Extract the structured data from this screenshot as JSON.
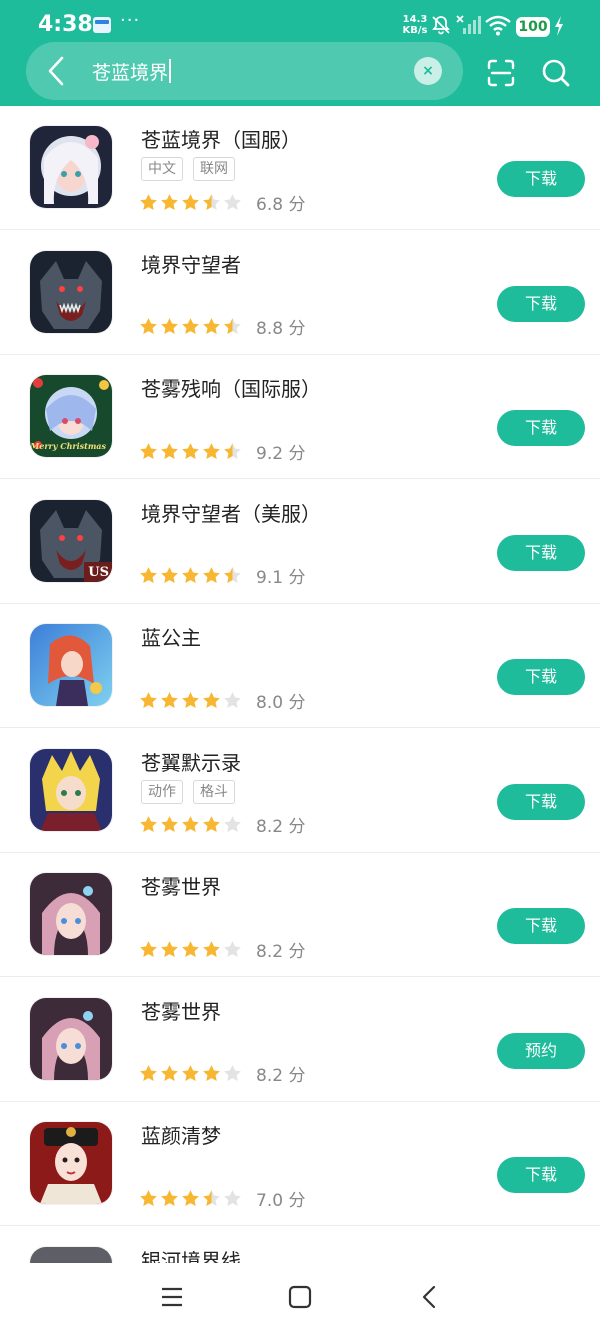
{
  "status_bar": {
    "time": "4:38",
    "dots": "···",
    "speed_value": "14.3",
    "speed_unit": "KB/s",
    "battery": "100"
  },
  "search": {
    "query": "苍蓝境界",
    "clear_glyph": "×"
  },
  "colors": {
    "brand": "#1ebc9a",
    "star_on": "#f7b733",
    "star_off": "#e3e3e3"
  },
  "apps": [
    {
      "name": "苍蓝境界（国服）",
      "tags": [
        "中文",
        "联网"
      ],
      "rating": 3.5,
      "score": "6.8 分",
      "action": "下载",
      "icon": "anime-girl-white-hair"
    },
    {
      "name": "境界守望者",
      "tags": [],
      "rating": 4.5,
      "score": "8.8 分",
      "action": "下载",
      "icon": "werewolf"
    },
    {
      "name": "苍雾残响（国际服）",
      "tags": [],
      "rating": 4.5,
      "score": "9.2 分",
      "action": "下载",
      "icon": "christmas-anime-girl",
      "icon_text": "Merry Christmas"
    },
    {
      "name": "境界守望者（美服）",
      "tags": [],
      "rating": 4.5,
      "score": "9.1 分",
      "action": "下载",
      "icon": "werewolf-us",
      "icon_text": "US"
    },
    {
      "name": "蓝公主",
      "tags": [],
      "rating": 4,
      "score": "8.0 分",
      "action": "下载",
      "icon": "blue-fantasy-princess"
    },
    {
      "name": "苍翼默示录",
      "tags": [
        "动作",
        "格斗"
      ],
      "rating": 4,
      "score": "8.2 分",
      "action": "下载",
      "icon": "blonde-anime-fighter"
    },
    {
      "name": "苍雾世界",
      "tags": [],
      "rating": 4,
      "score": "8.2 分",
      "action": "下载",
      "icon": "pink-hair-anime-girl"
    },
    {
      "name": "苍雾世界",
      "tags": [],
      "rating": 4,
      "score": "8.2 分",
      "action": "预约",
      "icon": "pink-hair-anime-girl"
    },
    {
      "name": "蓝颜清梦",
      "tags": [],
      "rating": 3.5,
      "score": "7.0 分",
      "action": "下载",
      "icon": "qing-dynasty-lady"
    },
    {
      "name": "银河境界线",
      "tags": [],
      "rating": null,
      "score": "",
      "action": "",
      "icon": "silver-hair-character"
    }
  ]
}
